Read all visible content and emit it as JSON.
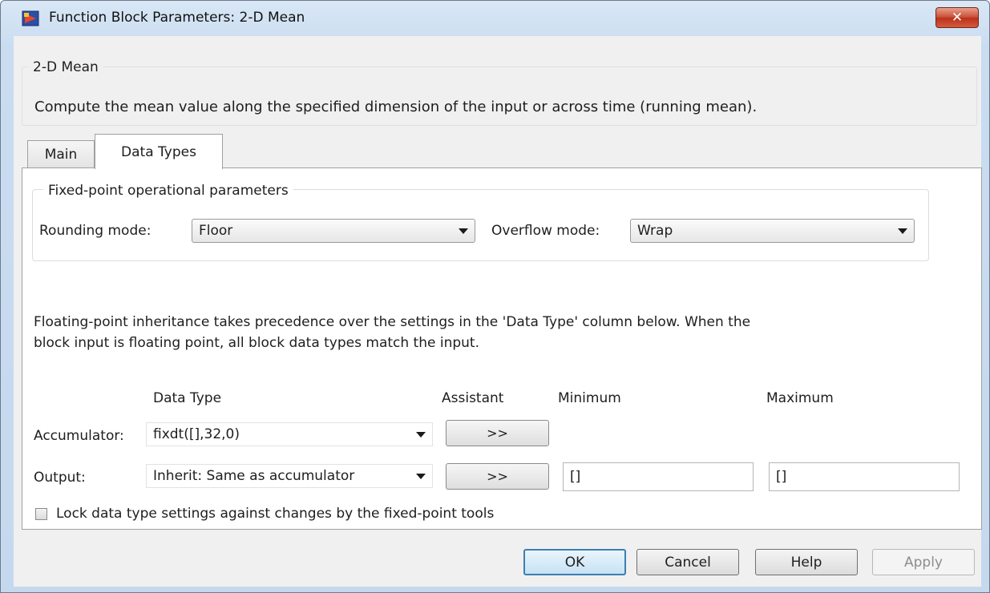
{
  "window": {
    "title": "Function Block Parameters: 2-D Mean",
    "close_label": "✕"
  },
  "description": {
    "group_title": "2-D Mean",
    "text": "Compute the mean value along the specified dimension of the input or across time (running mean)."
  },
  "tabs": [
    {
      "label": "Main",
      "selected": false
    },
    {
      "label": "Data Types",
      "selected": true
    }
  ],
  "fixed_point": {
    "group_title": "Fixed-point operational parameters",
    "rounding_label": "Rounding mode:",
    "rounding_value": "Floor",
    "overflow_label": "Overflow mode:",
    "overflow_value": "Wrap"
  },
  "inheritance_note": {
    "line1": "Floating-point inheritance takes precedence over the settings in the 'Data Type' column below. When the",
    "line2": "block input is floating point, all block data types match the input."
  },
  "table": {
    "headers": {
      "data_type": "Data Type",
      "assistant": "Assistant",
      "minimum": "Minimum",
      "maximum": "Maximum"
    },
    "rows": [
      {
        "label": "Accumulator:",
        "data_type": "fixdt([],32,0)",
        "assistant": ">>",
        "minimum": "",
        "maximum": ""
      },
      {
        "label": "Output:",
        "data_type": "Inherit: Same as accumulator",
        "assistant": ">>",
        "minimum": "[]",
        "maximum": "[]"
      }
    ]
  },
  "lock": {
    "label": "Lock data type settings against changes by the fixed-point tools",
    "checked": false
  },
  "buttons": {
    "ok": "OK",
    "cancel": "Cancel",
    "help": "Help",
    "apply": "Apply"
  }
}
